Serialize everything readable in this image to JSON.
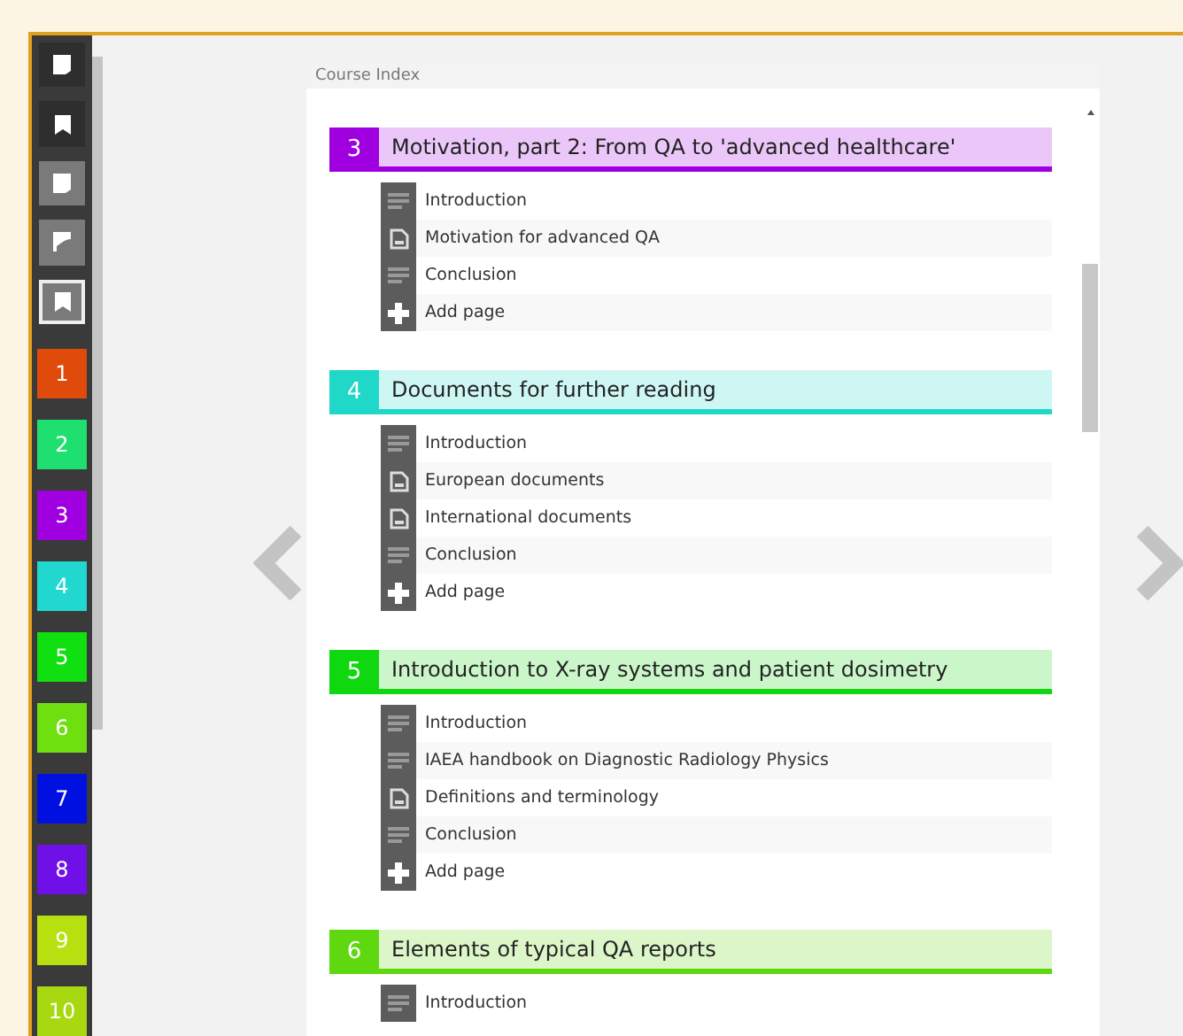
{
  "toolbar": [
    {
      "kind": "page",
      "selected": false
    },
    {
      "kind": "bookmark",
      "selected": false
    },
    {
      "kind": "page",
      "selected": false
    },
    {
      "kind": "flag",
      "selected": false
    },
    {
      "kind": "bookmark",
      "selected": true
    }
  ],
  "chapters": [
    {
      "label": "1",
      "color": "#e04a0a"
    },
    {
      "label": "2",
      "color": "#1ee070"
    },
    {
      "label": "3",
      "color": "#a000e0"
    },
    {
      "label": "4",
      "color": "#20d8d0"
    },
    {
      "label": "5",
      "color": "#10e010"
    },
    {
      "label": "6",
      "color": "#6ee010"
    },
    {
      "label": "7",
      "color": "#0010e0"
    },
    {
      "label": "8",
      "color": "#7010e8"
    },
    {
      "label": "9",
      "color": "#b8e010"
    },
    {
      "label": "10",
      "color": "#a8d810"
    }
  ],
  "panel": {
    "title": "Course Index"
  },
  "sections": [
    {
      "number": "3",
      "title": "Motivation, part 2: From QA to 'advanced healthcare'",
      "color": "#a000e0",
      "items": [
        {
          "kind": "text",
          "label": "Introduction"
        },
        {
          "kind": "doc",
          "label": "Motivation for advanced QA"
        },
        {
          "kind": "text",
          "label": "Conclusion"
        },
        {
          "kind": "add",
          "label": "Add page"
        }
      ]
    },
    {
      "number": "4",
      "title": "Documents for further reading",
      "color": "#20d8c8",
      "items": [
        {
          "kind": "text",
          "label": "Introduction"
        },
        {
          "kind": "doc",
          "label": "European documents"
        },
        {
          "kind": "doc",
          "label": "International documents"
        },
        {
          "kind": "text",
          "label": "Conclusion"
        },
        {
          "kind": "add",
          "label": "Add page"
        }
      ]
    },
    {
      "number": "5",
      "title": "Introduction to X-ray systems and patient dosimetry",
      "color": "#10d810",
      "items": [
        {
          "kind": "text",
          "label": "Introduction"
        },
        {
          "kind": "text",
          "label": "IAEA handbook on Diagnostic Radiology Physics"
        },
        {
          "kind": "doc",
          "label": "Definitions and terminology"
        },
        {
          "kind": "text",
          "label": "Conclusion"
        },
        {
          "kind": "add",
          "label": "Add page"
        }
      ]
    },
    {
      "number": "6",
      "title": "Elements of typical QA reports",
      "color": "#60d810",
      "items": [
        {
          "kind": "text",
          "label": "Introduction"
        }
      ]
    }
  ]
}
